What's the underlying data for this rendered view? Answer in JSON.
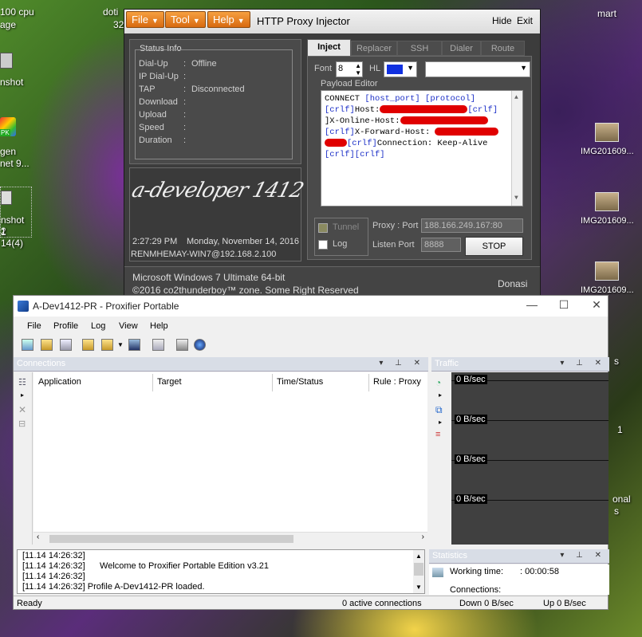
{
  "desktop": {
    "left_icons": [
      "100 cpu",
      "age",
      "nshot",
      "PK",
      "gen",
      "net 9...",
      "nshot 2",
      "1 14(4)"
    ],
    "top_icons": [
      "doti",
      "32",
      "mart"
    ],
    "right_icons": [
      "IMG201609...",
      "IMG201609...",
      "IMG201609..."
    ],
    "right_edge_text": [
      "s",
      "1",
      "onal",
      "s"
    ]
  },
  "injector": {
    "menu": [
      "File",
      "Tool",
      "Help"
    ],
    "title": "HTTP Proxy Injector",
    "hide": "Hide",
    "exit": "Exit",
    "status_header": "Status Info",
    "status": [
      {
        "label": "Dial-Up",
        "value": "Offline"
      },
      {
        "label": "IP Dial-Up",
        "value": ""
      },
      {
        "label": "TAP",
        "value": "Disconnected"
      },
      {
        "label": "Download",
        "value": ""
      },
      {
        "label": "Upload",
        "value": ""
      },
      {
        "label": "Speed",
        "value": ""
      },
      {
        "label": "Duration",
        "value": ""
      }
    ],
    "logo": "a-developer 1412",
    "time": "2:27:29 PM",
    "date": "Monday, November 14, 2016",
    "host": "RENMHEMAY-WIN7@192.168.2.100",
    "os": "Microsoft Windows 7 Ultimate  64-bit",
    "copyright": "©2016  co2thunderboy™ zone. Some Right Reserved",
    "credit": "Donasi",
    "tabs": [
      "Inject",
      "Replacer",
      "SSH",
      "Dialer",
      "Route"
    ],
    "font_label": "Font",
    "font_value": "8",
    "hl_label": "HL",
    "payload_header": "Payload Editor",
    "payload": {
      "l1a": "CONNECT ",
      "l1b": "[host_port] [protocol]",
      "l2a": "[crlf]",
      "l2b": "Host:",
      "l2c": "[crlf]",
      "l3a": "]X-Online-Host:",
      "l4a": "[crlf]",
      "l4b": "X-Forward-Host:",
      "l5a": "[crlf]",
      "l5b": "Connection: Keep-Alive",
      "l6a": "[crlf][crlf]"
    },
    "tunnel_label": "Tunnel",
    "log_label": "Log",
    "proxy_label": "Proxy : Port",
    "proxy_value": "188.166.249.167:80",
    "listen_label": "Listen Port",
    "listen_value": "8888",
    "stop_label": "STOP"
  },
  "proxifier": {
    "title": "A-Dev1412-PR - Proxifier Portable",
    "menu": [
      "File",
      "Profile",
      "Log",
      "View",
      "Help"
    ],
    "connections_title": "Connections",
    "columns": [
      "Application",
      "Target",
      "Time/Status",
      "Rule : Proxy"
    ],
    "traffic_title": "Traffic",
    "traffic_labels": [
      "0 B/sec",
      "0 B/sec",
      "0 B/sec",
      "0 B/sec"
    ],
    "log_lines": [
      "[11.14 14:26:32]",
      "[11.14 14:26:32]      Welcome to Proxifier Portable Edition v3.21",
      "[11.14 14:26:32]",
      "[11.14 14:26:32] Profile A-Dev1412-PR loaded."
    ],
    "statistics_title": "Statistics",
    "working_time_label": "Working time:",
    "working_time_value": ": 00:00:58",
    "connections_label": "Connections:",
    "status_ready": "Ready",
    "status_active": "0 active connections",
    "status_down": "Down 0 B/sec",
    "status_up": "Up 0 B/sec"
  }
}
